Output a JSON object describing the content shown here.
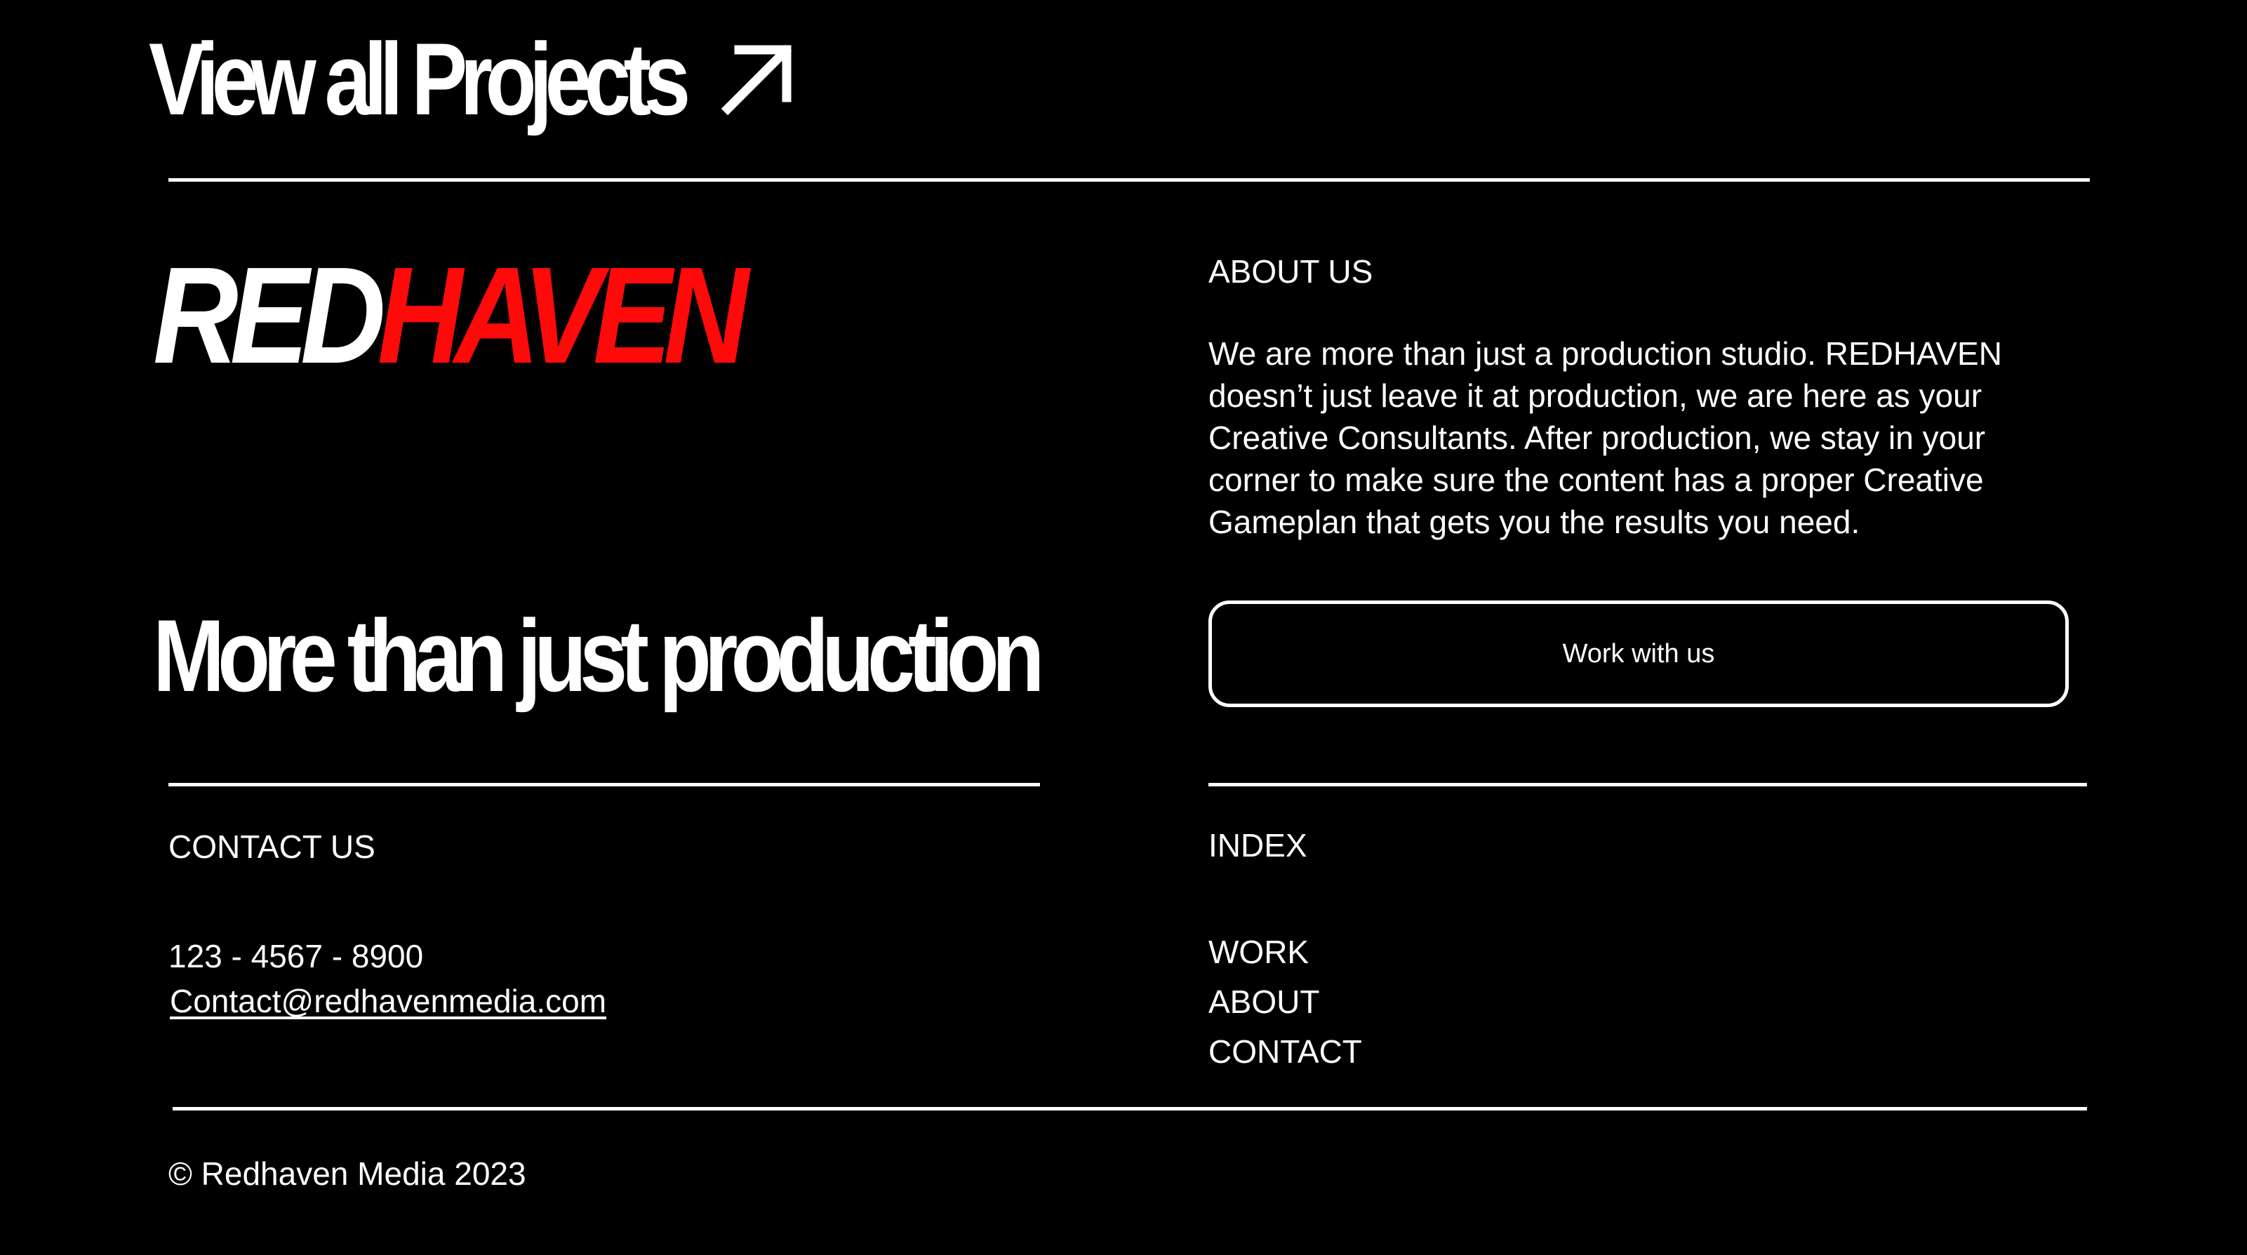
{
  "header": {
    "view_all_label": "View all Projects",
    "view_all_icon": "arrow-up-right-icon"
  },
  "logo": {
    "part_white": "RED",
    "part_red": "HAVEN",
    "accent_color": "#ff0a0a"
  },
  "tagline": "More than just production",
  "about": {
    "heading": "ABOUT US",
    "body": "We are more than just a production studio. REDHAVEN doesn’t just leave it at production, we are here as your Creative Consultants. After production, we stay in your corner to make sure the content has a proper Creative Gameplan that gets you the results you need.",
    "cta_label": "Work with us"
  },
  "contact": {
    "heading": "CONTACT US",
    "phone": "123 - 4567 - 8900",
    "email": "Contact@redhavenmedia.com"
  },
  "index": {
    "heading": "INDEX",
    "items": [
      {
        "label": "WORK"
      },
      {
        "label": "ABOUT"
      },
      {
        "label": "CONTACT"
      }
    ]
  },
  "footer": {
    "copyright": "© Redhaven Media 2023"
  },
  "colors": {
    "background": "#000000",
    "foreground": "#ffffff",
    "brand_red": "#ff0a0a"
  }
}
